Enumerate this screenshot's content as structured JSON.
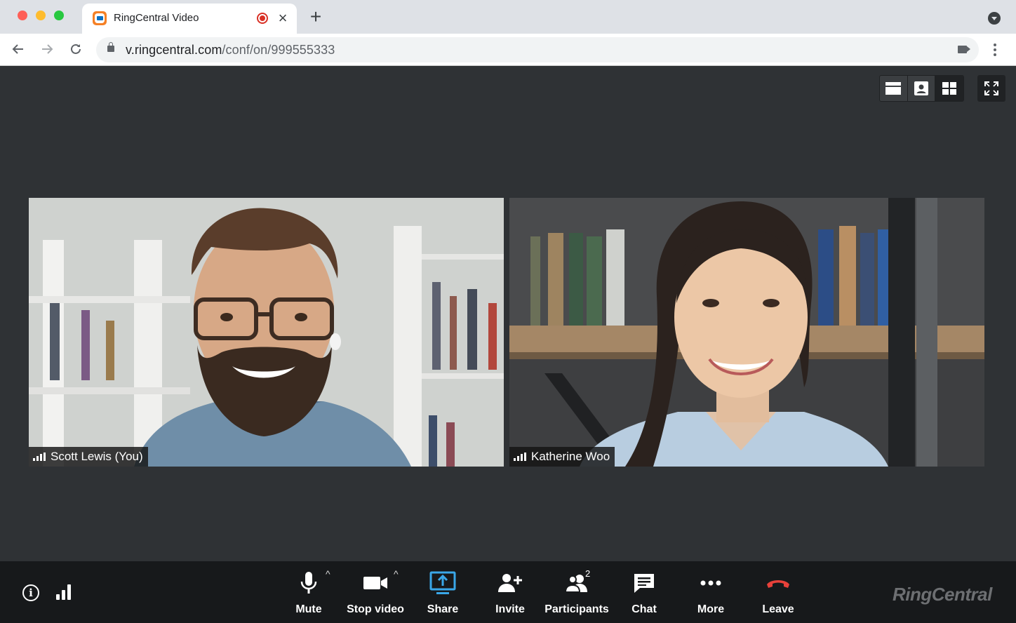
{
  "browser": {
    "tab": {
      "title": "RingCentral Video",
      "recording_color": "#d93025"
    },
    "address": {
      "host": "v.ringcentral.com",
      "path": "/conf/on/999555333"
    },
    "icons": [
      "back-arrow-icon",
      "forward-arrow-icon",
      "reload-icon",
      "lock-icon",
      "camera-icon",
      "more-vert-icon"
    ]
  },
  "meeting": {
    "view_modes": [
      "filmstrip-view",
      "speaker-view",
      "gallery-view"
    ],
    "active_view": "gallery-view",
    "participants": [
      {
        "name": "Scott Lewis (You)"
      },
      {
        "name": "Katherine Woo"
      }
    ]
  },
  "controls": {
    "mute": "Mute",
    "stop_video": "Stop video",
    "share": "Share",
    "invite": "Invite",
    "participants": "Participants",
    "participants_count": "2",
    "chat": "Chat",
    "more": "More",
    "leave": "Leave",
    "share_color": "#3aa7e8",
    "leave_color": "#e8413a"
  },
  "brand": {
    "logo_text": "RingCentral"
  }
}
